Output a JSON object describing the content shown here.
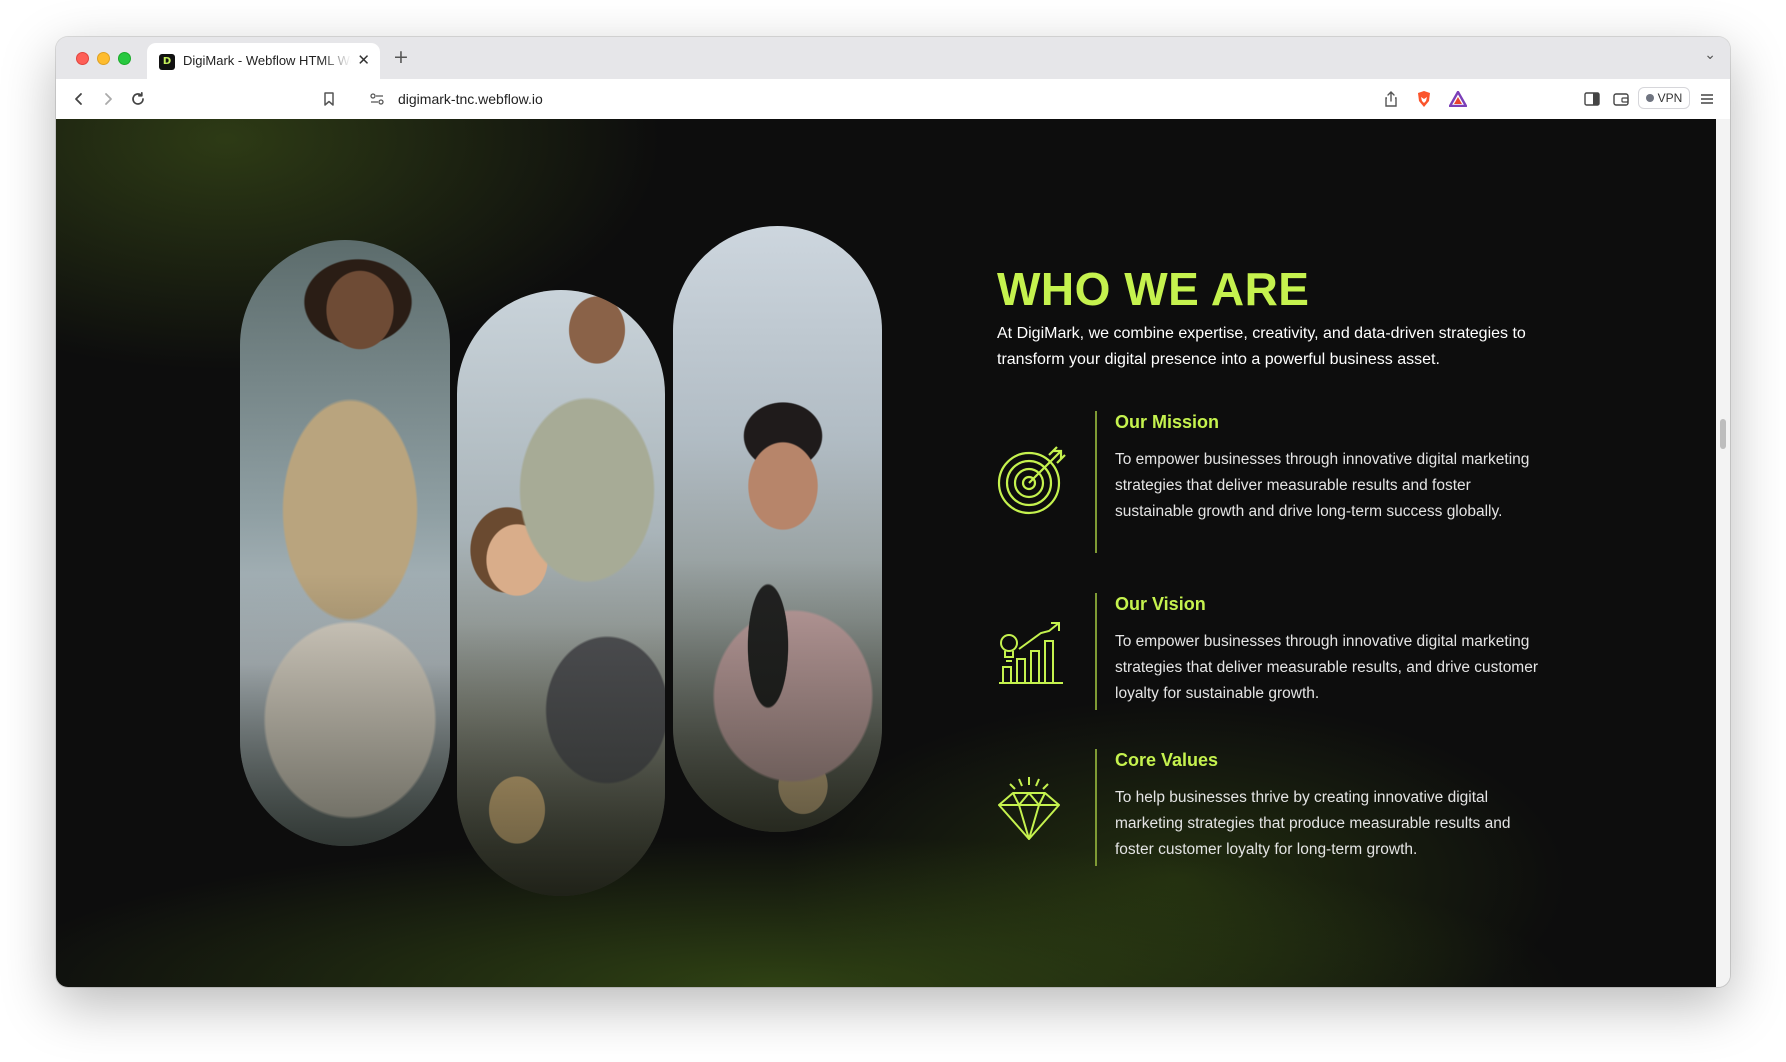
{
  "browser": {
    "tab_title": "DigiMark - Webflow HTML Website Template",
    "tab_favicon_text": "D",
    "new_tab_symbol": "+",
    "close_symbol": "✕",
    "url": "digimark-tnc.webflow.io",
    "vpn_label": "VPN"
  },
  "section": {
    "heading": "WHO WE ARE",
    "intro": "At DigiMark, we combine expertise, creativity, and data-driven strategies to transform your digital presence into a powerful business asset.",
    "items": [
      {
        "icon": "target-icon",
        "title": "Our Mission",
        "text": "To empower businesses through innovative digital marketing strategies that deliver measurable results and foster sustainable growth and drive long-term success globally."
      },
      {
        "icon": "growth-chart-icon",
        "title": "Our Vision",
        "text": "To empower businesses through innovative digital marketing strategies that deliver measurable results, and drive customer loyalty for sustainable growth."
      },
      {
        "icon": "diamond-icon",
        "title": "Core Values",
        "text": "To help businesses thrive by creating innovative digital marketing strategies that produce measurable results and foster customer loyalty for long-term growth."
      }
    ]
  },
  "colors": {
    "accent": "#c5f24e",
    "page_background": "#0d0d0d",
    "divider": "#7e9a34"
  }
}
